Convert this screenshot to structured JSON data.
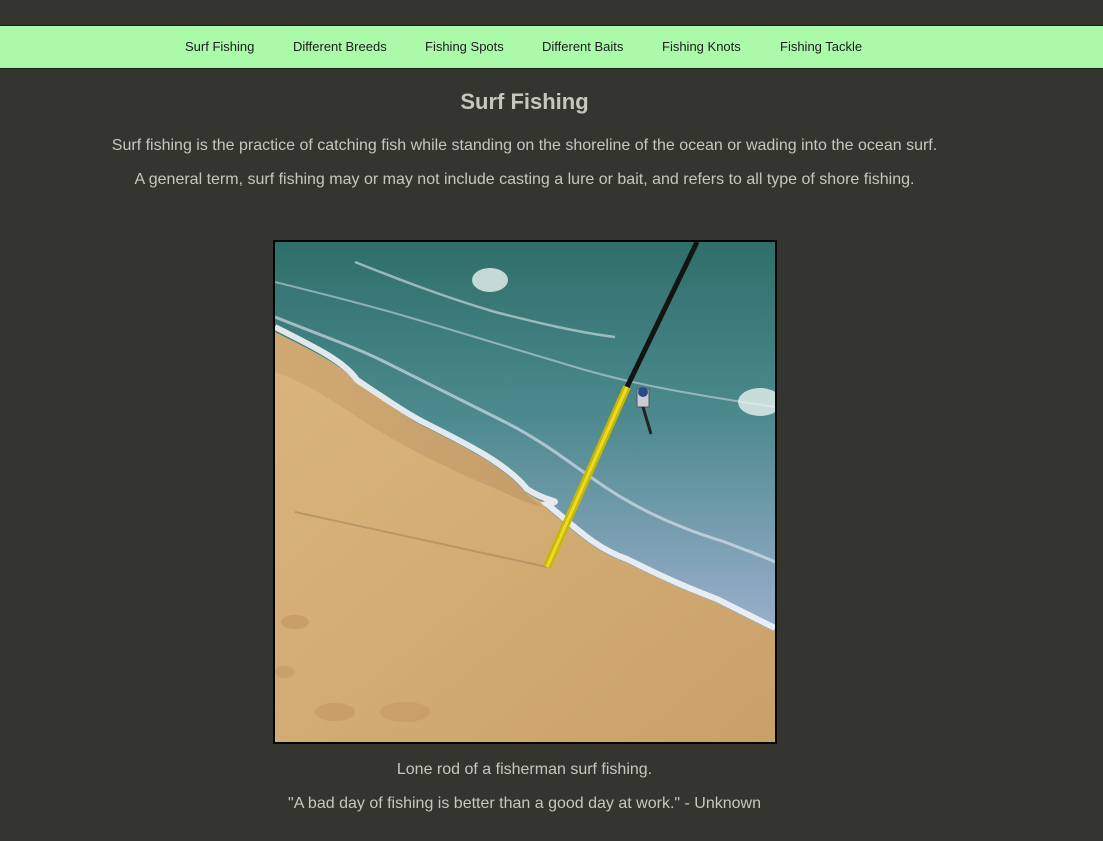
{
  "nav": {
    "items": [
      {
        "label": "Surf Fishing"
      },
      {
        "label": "Different Breeds"
      },
      {
        "label": "Fishing Spots"
      },
      {
        "label": "Different Baits"
      },
      {
        "label": "Fishing Knots"
      },
      {
        "label": "Fishing Tackle"
      }
    ]
  },
  "main": {
    "title": "Surf Fishing",
    "paragraphs": [
      "Surf fishing is the practice of catching fish while standing on the shoreline of the ocean or wading into the ocean surf.",
      "A general term, surf fishing may or may not include casting a lure or bait, and refers to all type of shore fishing."
    ],
    "caption": "Lone rod of a fisherman surf fishing.",
    "quote": "\"A bad day of fishing is better than a good day at work.\" - Unknown"
  },
  "colors": {
    "background": "#34352f",
    "navbar": "#aafaaa",
    "text": "#c7c7be",
    "nav_text": "#1c1c1c"
  }
}
